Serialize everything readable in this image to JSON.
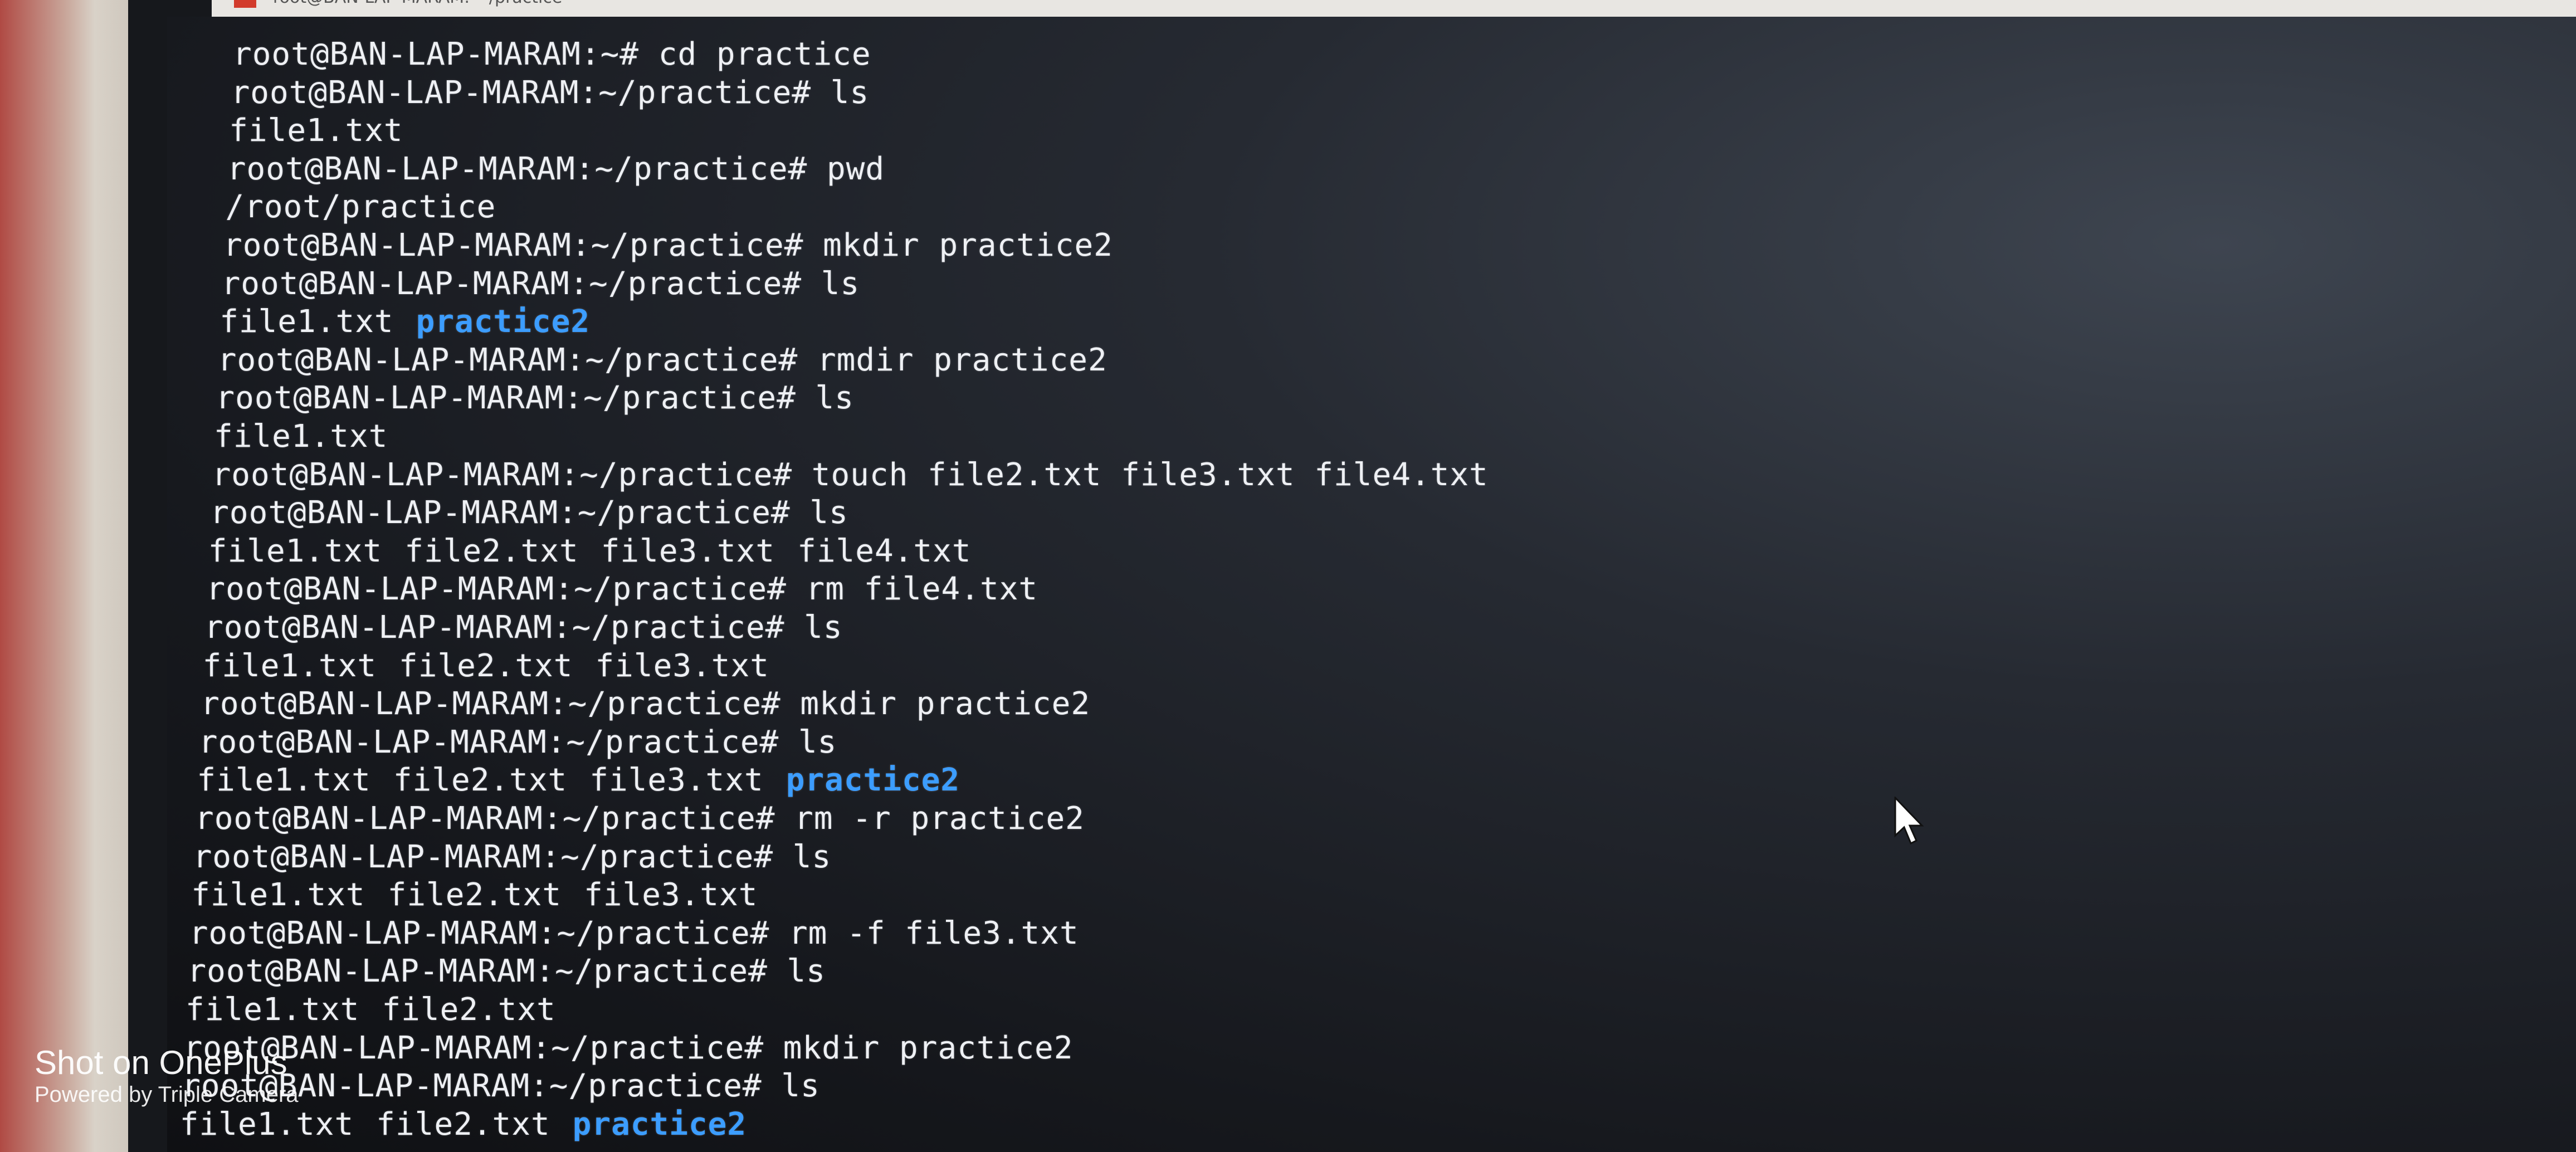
{
  "window": {
    "title": "root@BAN-LAP-MARAM: ~/practice",
    "accent_color": "#d23b2c"
  },
  "terminal": {
    "prompt": "root@BAN-LAP-MARAM",
    "directory_color": "#3c9dff",
    "lines": [
      {
        "type": "cmd",
        "text": "root@BAN-LAP-MARAM:~# cd practice"
      },
      {
        "type": "cmd",
        "text": "root@BAN-LAP-MARAM:~/practice# ls"
      },
      {
        "type": "out",
        "items": [
          {
            "text": "file1.txt"
          }
        ]
      },
      {
        "type": "cmd",
        "text": "root@BAN-LAP-MARAM:~/practice# pwd"
      },
      {
        "type": "out",
        "items": [
          {
            "text": "/root/practice"
          }
        ]
      },
      {
        "type": "cmd",
        "text": "root@BAN-LAP-MARAM:~/practice# mkdir practice2"
      },
      {
        "type": "cmd",
        "text": "root@BAN-LAP-MARAM:~/practice# ls"
      },
      {
        "type": "out",
        "items": [
          {
            "text": "file1.txt"
          },
          {
            "text": "practice2",
            "dir": true
          }
        ]
      },
      {
        "type": "cmd",
        "text": "root@BAN-LAP-MARAM:~/practice# rmdir practice2"
      },
      {
        "type": "cmd",
        "text": "root@BAN-LAP-MARAM:~/practice# ls"
      },
      {
        "type": "out",
        "items": [
          {
            "text": "file1.txt"
          }
        ]
      },
      {
        "type": "cmd",
        "text": "root@BAN-LAP-MARAM:~/practice# touch file2.txt file3.txt file4.txt"
      },
      {
        "type": "cmd",
        "text": "root@BAN-LAP-MARAM:~/practice# ls"
      },
      {
        "type": "out",
        "items": [
          {
            "text": "file1.txt"
          },
          {
            "text": "file2.txt"
          },
          {
            "text": "file3.txt"
          },
          {
            "text": "file4.txt"
          }
        ]
      },
      {
        "type": "cmd",
        "text": "root@BAN-LAP-MARAM:~/practice# rm file4.txt"
      },
      {
        "type": "cmd",
        "text": "root@BAN-LAP-MARAM:~/practice# ls"
      },
      {
        "type": "out",
        "items": [
          {
            "text": "file1.txt"
          },
          {
            "text": "file2.txt"
          },
          {
            "text": "file3.txt"
          }
        ]
      },
      {
        "type": "cmd",
        "text": "root@BAN-LAP-MARAM:~/practice# mkdir practice2"
      },
      {
        "type": "cmd",
        "text": "root@BAN-LAP-MARAM:~/practice# ls"
      },
      {
        "type": "out",
        "items": [
          {
            "text": "file1.txt"
          },
          {
            "text": "file2.txt"
          },
          {
            "text": "file3.txt"
          },
          {
            "text": "practice2",
            "dir": true
          }
        ]
      },
      {
        "type": "cmd",
        "text": "root@BAN-LAP-MARAM:~/practice# rm -r practice2"
      },
      {
        "type": "cmd",
        "text": "root@BAN-LAP-MARAM:~/practice# ls"
      },
      {
        "type": "out",
        "items": [
          {
            "text": "file1.txt"
          },
          {
            "text": "file2.txt"
          },
          {
            "text": "file3.txt"
          }
        ]
      },
      {
        "type": "cmd",
        "text": "root@BAN-LAP-MARAM:~/practice# rm -f file3.txt"
      },
      {
        "type": "cmd",
        "text": "root@BAN-LAP-MARAM:~/practice# ls"
      },
      {
        "type": "out",
        "items": [
          {
            "text": "file1.txt"
          },
          {
            "text": "file2.txt"
          }
        ]
      },
      {
        "type": "cmd",
        "text": "root@BAN-LAP-MARAM:~/practice# mkdir practice2"
      },
      {
        "type": "cmd",
        "text": "root@BAN-LAP-MARAM:~/practice# ls"
      },
      {
        "type": "out",
        "items": [
          {
            "text": "file1.txt"
          },
          {
            "text": "file2.txt"
          },
          {
            "text": "practice2",
            "dir": true
          }
        ]
      }
    ]
  },
  "cursor": {
    "icon": "mouse-pointer-icon"
  },
  "watermark": {
    "title": "Shot on OnePlus",
    "subtitle": "Powered by Triple Camera"
  }
}
